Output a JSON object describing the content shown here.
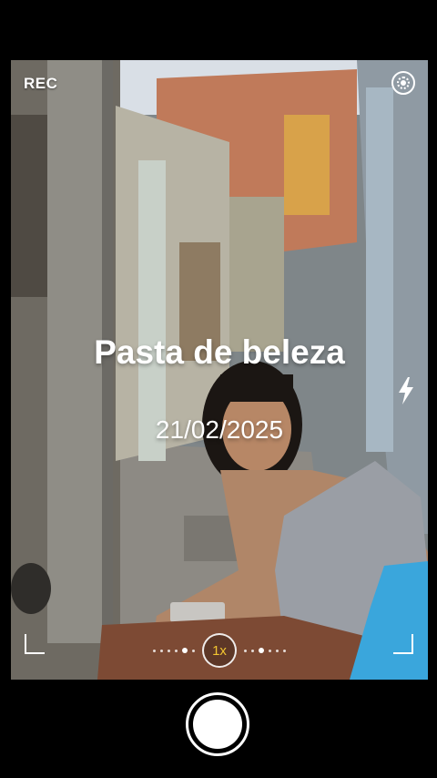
{
  "status": {
    "rec_label": "REC"
  },
  "overlay": {
    "title": "Pasta de beleza",
    "date": "21/02/2025"
  },
  "zoom": {
    "label": "1x"
  },
  "colors": {
    "zoom_accent": "#f2c531",
    "background": "#000000"
  },
  "icons": [
    "live-photo-icon",
    "flash-icon",
    "shutter-button"
  ]
}
